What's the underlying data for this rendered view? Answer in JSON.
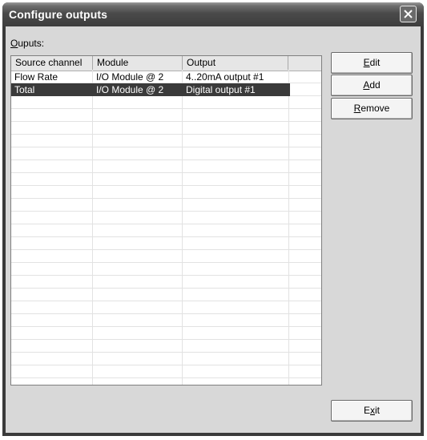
{
  "window": {
    "title": "Configure outputs"
  },
  "outputs_label": "Ouputs:",
  "table": {
    "columns": [
      "Source channel",
      "Module",
      "Output"
    ],
    "rows": [
      {
        "source": "Flow Rate",
        "module": "I/O Module @ 2",
        "output": "4..20mA output #1",
        "selected": false
      },
      {
        "source": "Total",
        "module": "I/O Module @ 2",
        "output": "Digital output #1",
        "selected": true
      }
    ]
  },
  "buttons": {
    "edit": {
      "mnemonic": "E",
      "rest": "dit"
    },
    "add": {
      "mnemonic": "A",
      "rest": "dd"
    },
    "remove": {
      "mnemonic": "R",
      "rest": "emove"
    },
    "exit": {
      "pre": "E",
      "mnemonic": "x",
      "rest": "it"
    }
  },
  "icons": {
    "close": "close-x-icon"
  },
  "colors": {
    "selection": "#3a3a3a",
    "titlebar": "#4a4a4a"
  }
}
